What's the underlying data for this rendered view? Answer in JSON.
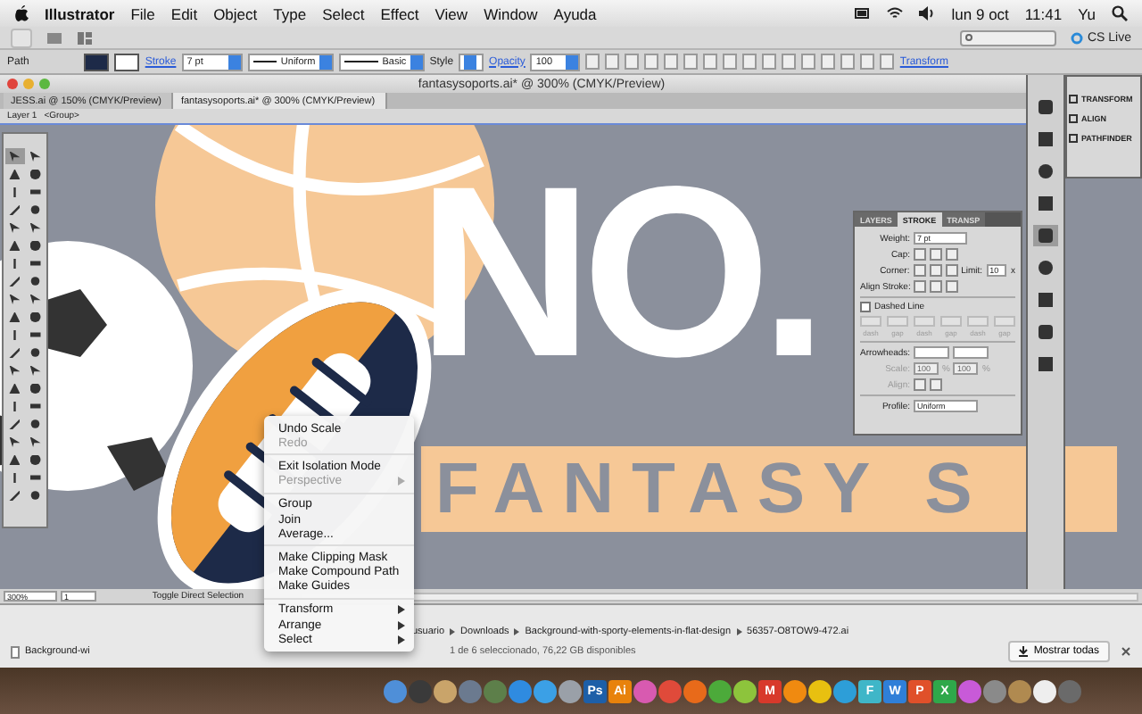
{
  "menu_bar": {
    "app": "Illustrator",
    "items": [
      "File",
      "Edit",
      "Object",
      "Type",
      "Select",
      "Effect",
      "View",
      "Window",
      "Ayuda"
    ],
    "date": "lun 9 oct",
    "time": "11:41",
    "user": "Yu"
  },
  "app_bar": {
    "cs_live": "CS Live"
  },
  "control_bar": {
    "selection": "Path",
    "stroke_label": "Stroke",
    "weight": "7 pt",
    "profile": "Uniform",
    "brush": "Basic",
    "style_label": "Style",
    "opacity_label": "Opacity",
    "opacity": "100",
    "transform_label": "Transform"
  },
  "document": {
    "title": "fantasysoports.ai* @ 300% (CMYK/Preview)",
    "tabs": [
      {
        "label": "JESS.ai @ 150% (CMYK/Preview)",
        "selected": false
      },
      {
        "label": "fantasysoports.ai* @ 300% (CMYK/Preview)",
        "selected": true
      }
    ],
    "breadcrumb": [
      "Layer 1",
      "<Group>"
    ]
  },
  "artwork": {
    "headline": "NO.",
    "band_text": "FANTASY S"
  },
  "stroke_panel": {
    "tabs": [
      {
        "label": "LAYERS",
        "selected": false
      },
      {
        "label": "STROKE",
        "selected": true
      },
      {
        "label": "TRANSP",
        "selected": false
      }
    ],
    "weight_label": "Weight:",
    "weight": "7 pt",
    "cap_label": "Cap:",
    "corner_label": "Corner:",
    "limit_label": "Limit:",
    "limit": "10",
    "limit_unit": "x",
    "align_label": "Align Stroke:",
    "dashed": {
      "label": "Dashed Line",
      "checked": false
    },
    "dash_labels": [
      "dash",
      "gap",
      "dash",
      "gap",
      "dash",
      "gap"
    ],
    "arrowheads_label": "Arrowheads:",
    "scale_label": "Scale:",
    "scale_start": "100",
    "scale_end": "100",
    "percent": "%",
    "align_arrows_label": "Align:",
    "profile_label": "Profile:",
    "profile": "Uniform"
  },
  "panel_dock": {
    "items": [
      "TRANSFORM",
      "ALIGN",
      "PATHFINDER"
    ]
  },
  "status_bar": {
    "zoom": "300%",
    "artboard": "1",
    "tool": "Toggle Direct Selection"
  },
  "context_menu": [
    {
      "kind": "item",
      "label": "Undo Scale",
      "disabled": false,
      "submenu": false
    },
    {
      "kind": "item",
      "label": "Redo",
      "disabled": true,
      "submenu": false
    },
    {
      "kind": "separator"
    },
    {
      "kind": "item",
      "label": "Exit Isolation Mode",
      "disabled": false,
      "submenu": false
    },
    {
      "kind": "item",
      "label": "Perspective",
      "disabled": true,
      "submenu": true
    },
    {
      "kind": "separator"
    },
    {
      "kind": "item",
      "label": "Group",
      "disabled": false,
      "submenu": false
    },
    {
      "kind": "item",
      "label": "Join",
      "disabled": false,
      "submenu": false
    },
    {
      "kind": "item",
      "label": "Average...",
      "disabled": false,
      "submenu": false
    },
    {
      "kind": "separator"
    },
    {
      "kind": "item",
      "label": "Make Clipping Mask",
      "disabled": false,
      "submenu": false
    },
    {
      "kind": "item",
      "label": "Make Compound Path",
      "disabled": false,
      "submenu": false
    },
    {
      "kind": "item",
      "label": "Make Guides",
      "disabled": false,
      "submenu": false
    },
    {
      "kind": "separator"
    },
    {
      "kind": "item",
      "label": "Transform",
      "disabled": false,
      "submenu": true
    },
    {
      "kind": "item",
      "label": "Arrange",
      "disabled": false,
      "submenu": true
    },
    {
      "kind": "item",
      "label": "Select",
      "disabled": false,
      "submenu": true
    }
  ],
  "finder": {
    "download": "Background-wi",
    "path": [
      "usuario",
      "Downloads",
      "Background-with-sporty-elements-in-flat-design",
      "56357-O8TOW9-472.ai"
    ],
    "status": "1 de 6 seleccionado, 76,22 GB disponibles",
    "show_all": "Mostrar todas"
  },
  "dock": [
    {
      "color": "#4f8fd8"
    },
    {
      "color": "#3a3a3a"
    },
    {
      "color": "#c9a46a"
    },
    {
      "color": "#6b7a8f"
    },
    {
      "color": "#5d7f4a"
    },
    {
      "color": "#2f8be0"
    },
    {
      "color": "#3ba0e6"
    },
    {
      "color": "#9aa0a8"
    },
    {
      "color": "#1d5fa8",
      "label": "Ps"
    },
    {
      "color": "#e8820c",
      "label": "Ai"
    },
    {
      "color": "#d85ab0"
    },
    {
      "color": "#e04a3a"
    },
    {
      "color": "#e86a1a"
    },
    {
      "color": "#4caa3a"
    },
    {
      "color": "#8dc43c"
    },
    {
      "color": "#d8392b",
      "label": "M"
    },
    {
      "color": "#f08a10"
    },
    {
      "color": "#e8c010"
    },
    {
      "color": "#2d9ed8"
    },
    {
      "color": "#3fb6c8",
      "label": "F"
    },
    {
      "color": "#2f7fd8",
      "label": "W"
    },
    {
      "color": "#e0502a",
      "label": "P"
    },
    {
      "color": "#2fa84a",
      "label": "X"
    },
    {
      "color": "#c85ad8"
    },
    {
      "color": "#8a8a8a"
    },
    {
      "color": "#b08a50"
    },
    {
      "color": "#eeeeee"
    },
    {
      "color": "#6a6a6a"
    }
  ]
}
